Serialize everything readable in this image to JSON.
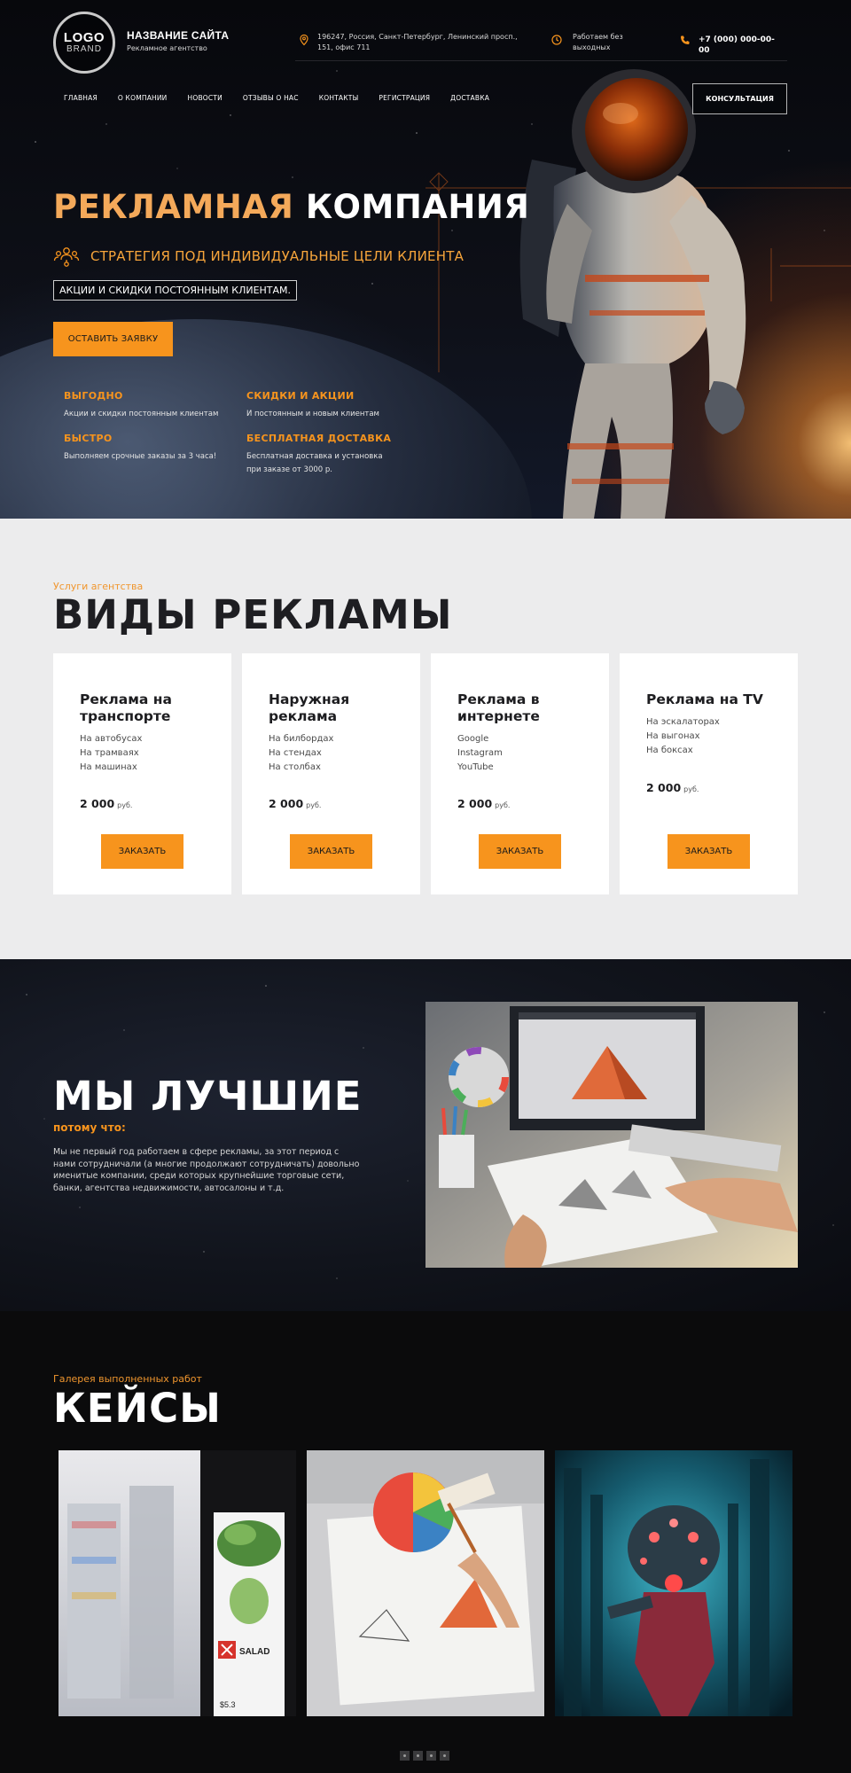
{
  "header": {
    "logo_line1": "LOGO",
    "logo_line2": "BRAND",
    "site_name": "НАЗВАНИЕ САЙТА",
    "site_subtitle": "Рекламное агентство",
    "address": "196247, Россия, Санкт-Петербург, Ленинский просп., 151, офис 711",
    "hours": "Работаем без выходных",
    "phone": "+7 (000) 000-00-00",
    "nav": [
      "ГЛАВНАЯ",
      "О КОМПАНИИ",
      "НОВОСТИ",
      "ОТЗЫВЫ О НАС",
      "КОНТАКТЫ",
      "РЕГИСТРАЦИЯ",
      "ДОСТАВКА"
    ],
    "consult_button": "КОНСУЛЬТАЦИЯ"
  },
  "hero": {
    "title_part1": "РЕКЛАМНАЯ",
    "title_part2": "КОМПАНИЯ",
    "strategy": "СТРАТЕГИЯ ПОД ИНДИВИДУАЛЬНЫЕ ЦЕЛИ КЛИЕНТА",
    "promo": "АКЦИИ И СКИДКИ ПОСТОЯННЫМ КЛИЕНТАМ.",
    "cta": "ОСТАВИТЬ ЗАЯВКУ",
    "features": [
      {
        "title": "ВЫГОДНО",
        "text": "Акции и скидки постоянным клиентам"
      },
      {
        "title": "СКИДКИ И АКЦИИ",
        "text": "И постоянным и новым клиентам"
      },
      {
        "title": "БЫСТРО",
        "text": "Выполняем срочные заказы за 3 часа!"
      },
      {
        "title": "БЕСПЛАТНАЯ ДОСТАВКА",
        "text": "Бесплатная доставка и установка при заказе от 3000 р."
      }
    ]
  },
  "services": {
    "eyebrow": "Услуги агентства",
    "title": "ВИДЫ РЕКЛАМЫ",
    "cards": [
      {
        "title": "Реклама на транспорте",
        "items": [
          "На автобусах",
          "На трамваях",
          "На машинах"
        ],
        "price": "2 000",
        "currency": "руб.",
        "button": "ЗАКАЗАТЬ"
      },
      {
        "title": "Наружная реклама",
        "items": [
          "На билбордах",
          "На стендах",
          "На столбах"
        ],
        "price": "2 000",
        "currency": "руб.",
        "button": "ЗАКАЗАТЬ"
      },
      {
        "title": "Реклама в интернете",
        "items": [
          "Google",
          "Instagram",
          "YouTube"
        ],
        "price": "2 000",
        "currency": "руб.",
        "button": "ЗАКАЗАТЬ"
      },
      {
        "title": "Реклама на TV",
        "items": [
          "На эскалаторах",
          "На выгонах",
          "На боксах"
        ],
        "price": "2 000",
        "currency": "руб.",
        "button": "ЗАКАЗАТЬ"
      }
    ]
  },
  "best": {
    "title": "МЫ ЛУЧШИЕ",
    "subtitle": "потому что:",
    "text": "Мы не первый год работаем в сфере рекламы, за этот период с нами сотрудничали (а многие продолжают сотрудничать) довольно именитые компании, среди которых крупнейшие торговые сети, банки, агентства недвижимости, автосалоны и т.д."
  },
  "cases": {
    "eyebrow": "Галерея выполненных работ",
    "title": "КЕЙСЫ",
    "salad_label": "SALAD",
    "salad_price": "$5.3",
    "slides": 4
  },
  "colors": {
    "accent": "#f7941d",
    "hero_title_accent": "#f4a95a",
    "light_bg": "#ececed",
    "dark_bg": "#0b0b0c"
  },
  "icons": [
    "map-pin-icon",
    "clock-icon",
    "phone-icon",
    "team-icon"
  ]
}
